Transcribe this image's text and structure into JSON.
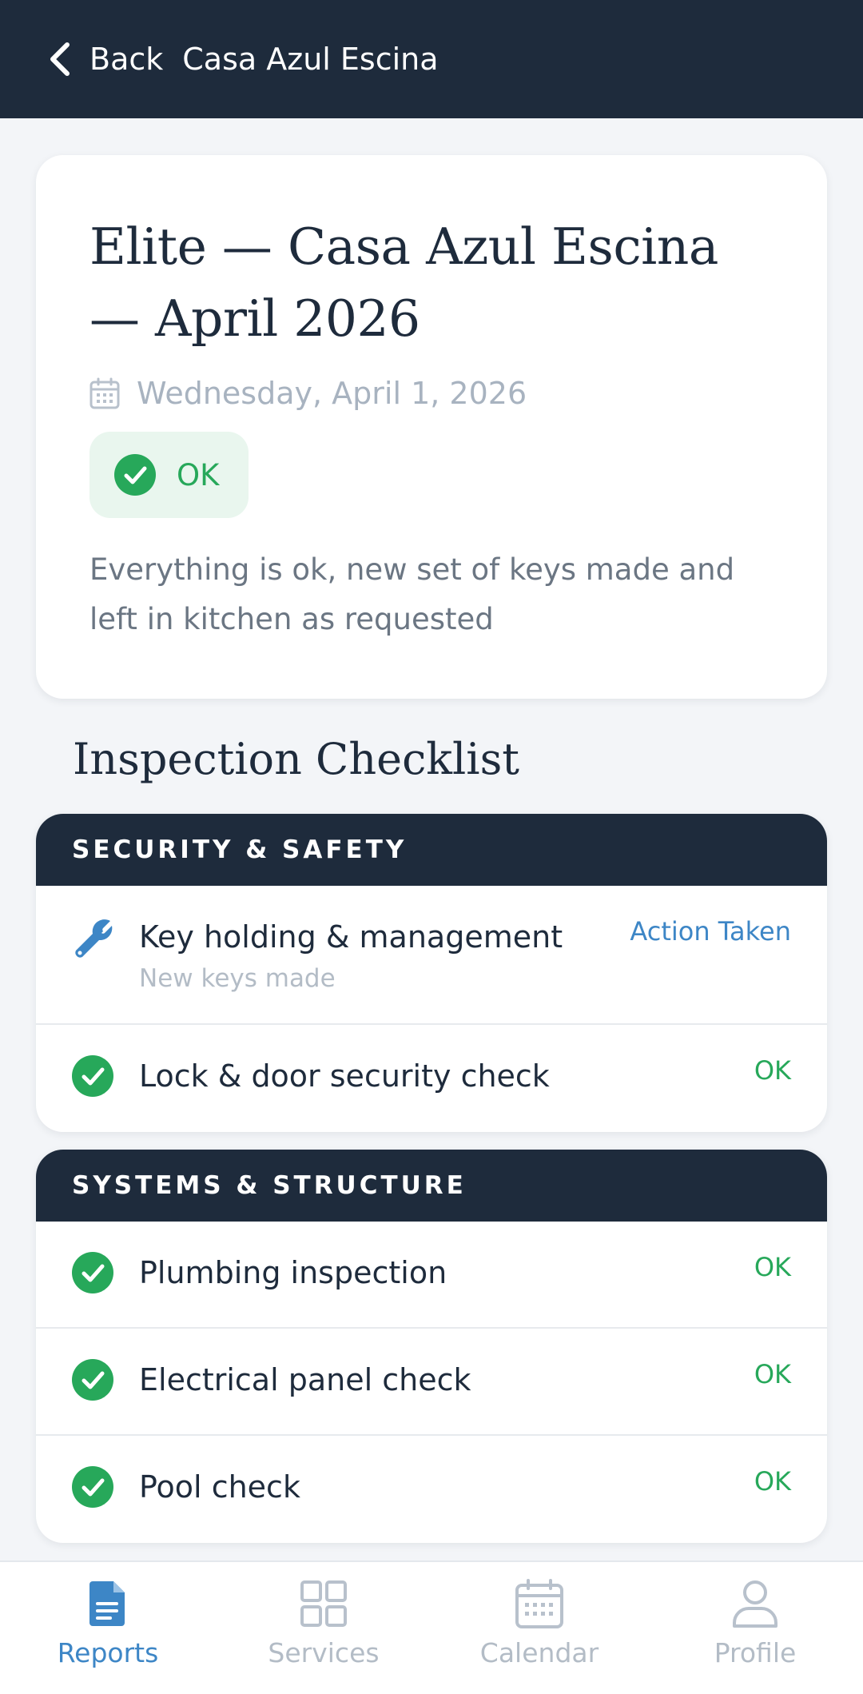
{
  "header": {
    "back_label": "Back",
    "title": "Casa Azul Escina"
  },
  "report": {
    "title": "Elite — Casa Azul Escina — April 2026",
    "date": "Wednesday, April 1, 2026",
    "status": "OK",
    "notes": "Everything is ok, new set of keys made and left in kitchen as requested"
  },
  "checklist": {
    "heading": "Inspection Checklist",
    "groups": [
      {
        "title": "SECURITY & SAFETY",
        "items": [
          {
            "label": "Key holding & management",
            "sub": "New keys made",
            "status": "Action Taken",
            "icon": "wrench-icon"
          },
          {
            "label": "Lock & door security check",
            "status": "OK",
            "icon": "check-circle-icon"
          }
        ]
      },
      {
        "title": "SYSTEMS & STRUCTURE",
        "items": [
          {
            "label": "Plumbing inspection",
            "status": "OK",
            "icon": "check-circle-icon"
          },
          {
            "label": "Electrical panel check",
            "status": "OK",
            "icon": "check-circle-icon"
          },
          {
            "label": "Pool check",
            "status": "OK",
            "icon": "check-circle-icon"
          }
        ]
      }
    ]
  },
  "tabs": [
    {
      "label": "Reports",
      "icon": "document-icon",
      "active": true
    },
    {
      "label": "Services",
      "icon": "grid-icon",
      "active": false
    },
    {
      "label": "Calendar",
      "icon": "calendar-icon",
      "active": false
    },
    {
      "label": "Profile",
      "icon": "person-icon",
      "active": false
    }
  ],
  "colors": {
    "navy": "#1e2b3c",
    "ok_green": "#27a85a",
    "action_blue": "#3d86c6",
    "muted": "#b3bcc6"
  }
}
